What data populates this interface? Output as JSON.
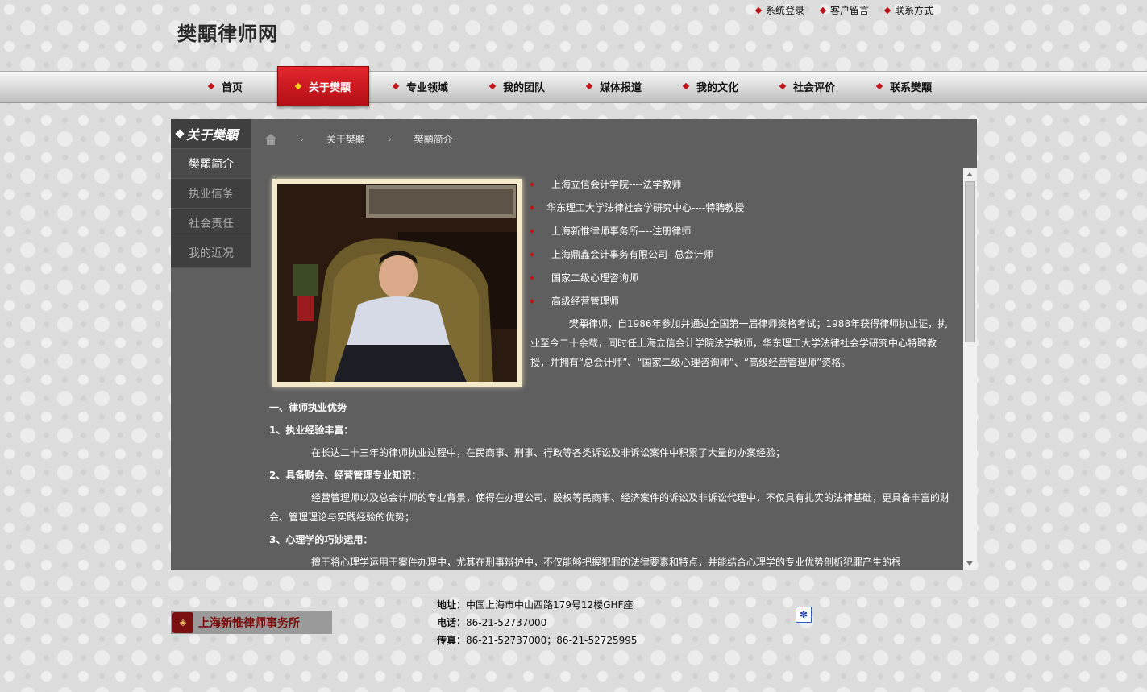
{
  "site": {
    "logo": "樊顒律师网"
  },
  "top_links": [
    "系统登录",
    "客户留言",
    "联系方式"
  ],
  "nav": {
    "items": [
      "首页",
      "关于樊顒",
      "专业领域",
      "我的团队",
      "媒体报道",
      "我的文化",
      "社会评价",
      "联系樊顒"
    ],
    "active_index": 1
  },
  "sidebar": {
    "title": "关于樊顒",
    "items": [
      "樊顒简介",
      "执业信条",
      "社会责任",
      "我的近况"
    ],
    "active_index": 0
  },
  "breadcrumb": [
    "关于樊顒",
    "樊顒简介"
  ],
  "qualifications": [
    "上海立信会计学院----法学教师",
    "华东理工大学法律社会学研究中心----特聘教授",
    "上海新惟律师事务所----注册律师",
    "上海鼎鑫会计事务有限公司--总会计师",
    "国家二级心理咨询师",
    "高级经营管理师"
  ],
  "intro": "樊顒律师，自1986年参加并通过全国第一届律师资格考试；1988年获得律师执业证，执业至今二十余载，同时任上海立信会计学院法学教师，华东理工大学法律社会学研究中心特聘教授，并拥有“总会计师”、“国家二级心理咨询师”、“高级经营管理师”资格。",
  "sections": {
    "h1": "一、律师执业优势",
    "s1_title": "1、执业经验丰富：",
    "s1_text": "在长达二十三年的律师执业过程中，在民商事、刑事、行政等各类诉讼及非诉讼案件中积累了大量的办案经验；",
    "s2_title": "2、具备财会、经营管理专业知识：",
    "s2_text": "经营管理师以及总会计师的专业背景，使得在办理公司、股权等民商事、经济案件的诉讼及非诉讼代理中，不仅具有扎实的法律基础，更具备丰富的财会、管理理论与实践经验的优势；",
    "s3_title": "3、心理学的巧妙运用：",
    "s3_text": "擅于将心理学运用于案件办理中，尤其在刑事辩护中，不仅能够把握犯罪的法律要素和特点，并能结合心理学的专业优势剖析犯罪产生的根"
  },
  "footer": {
    "logo_text": "上海新惟律师事务所",
    "address_label": "地址：",
    "address": "中国上海市中山西路179号12楼GHF座",
    "phone_label": "电话：",
    "phone": "86-21-52737000",
    "fax_label": "传真：",
    "fax": "86-21-52737000；86-21-52725995"
  },
  "colors": {
    "accent": "#c0141c",
    "panel": "#5f5f5f",
    "sidebar": "#3f3f3f"
  }
}
